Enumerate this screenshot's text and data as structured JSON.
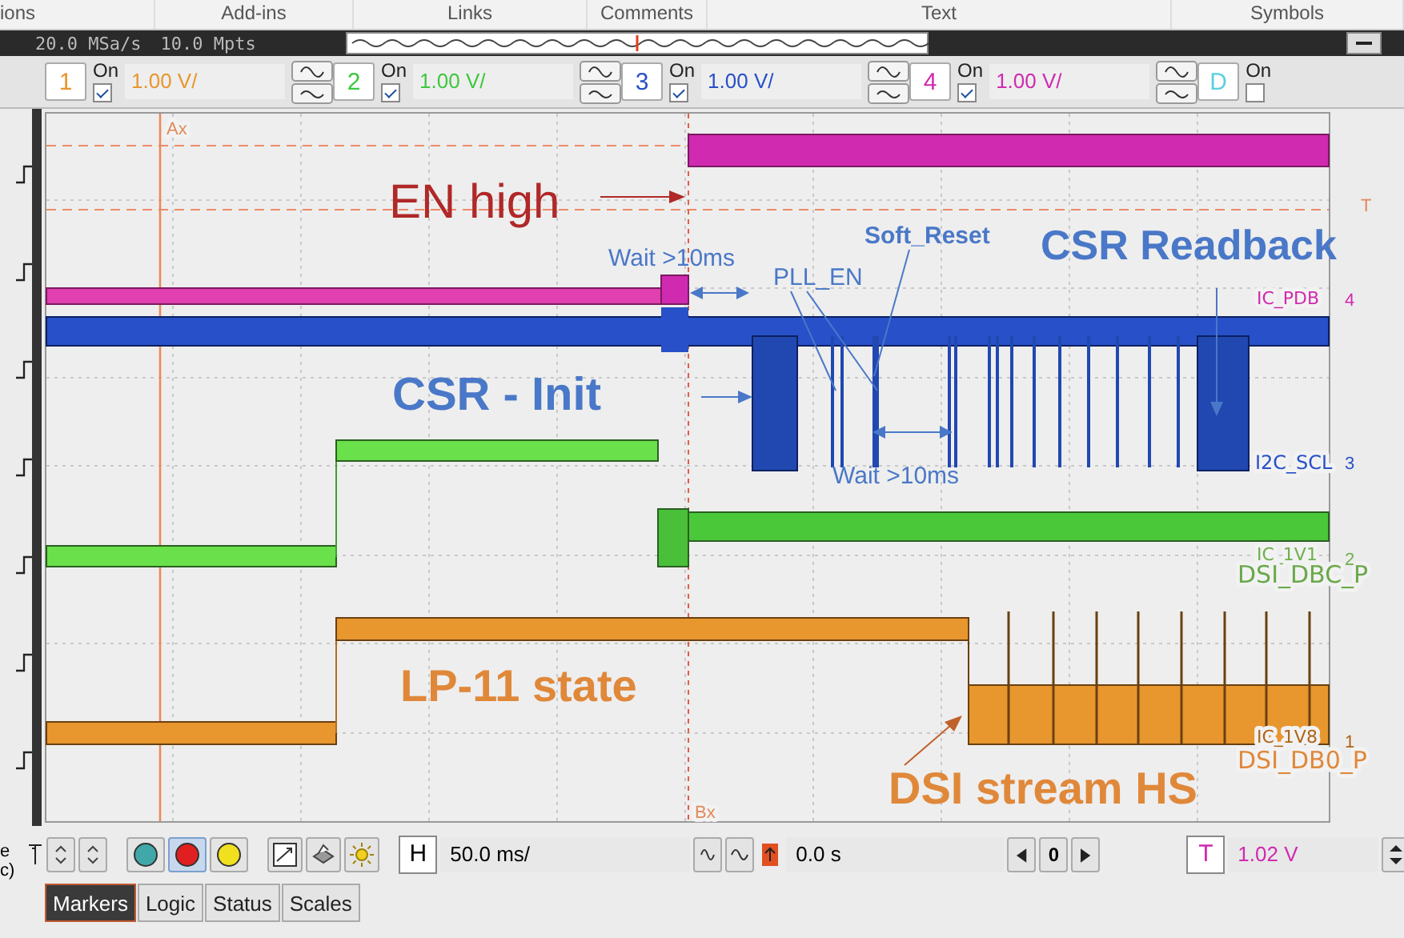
{
  "menu_tabs": [
    "ions",
    "Add-ins",
    "Links",
    "Comments",
    "Text",
    "Symbols"
  ],
  "acquisition": {
    "sample_rate": "20.0 MSa/s",
    "memory_depth": "10.0 Mpts"
  },
  "channels": [
    {
      "number": "1",
      "on_label": "On",
      "checked": true,
      "scale": "1.00 V/",
      "color": "#e8962e"
    },
    {
      "number": "2",
      "on_label": "On",
      "checked": true,
      "scale": "1.00 V/",
      "color": "#3ec83e"
    },
    {
      "number": "3",
      "on_label": "On",
      "checked": true,
      "scale": "1.00 V/",
      "color": "#2850c8"
    },
    {
      "number": "4",
      "on_label": "On",
      "checked": true,
      "scale": "1.00 V/",
      "color": "#d02ab0"
    }
  ],
  "digital": {
    "label": "D",
    "on_label": "On",
    "checked": false
  },
  "plot": {
    "markers": [
      "Ax",
      "Bx"
    ],
    "trigger_level_label": "T",
    "annotations": [
      {
        "text": "EN high",
        "color": "#b02828"
      },
      {
        "text": "Wait >10ms",
        "color": "#4a78c8"
      },
      {
        "text": "PLL_EN",
        "color": "#4a78c8"
      },
      {
        "text": "Soft_Reset",
        "color": "#4a78c8"
      },
      {
        "text": "CSR Readback",
        "color": "#4a78c8"
      },
      {
        "text": "CSR - Init",
        "color": "#4a78c8"
      },
      {
        "text": "Wait >10ms",
        "color": "#4a78c8"
      },
      {
        "text": "LP-11 state",
        "color": "#e0883a"
      },
      {
        "text": "DSI stream HS",
        "color": "#e0883a"
      }
    ],
    "trace_labels": [
      {
        "text": "IC_PDB",
        "color": "#d02ab0",
        "channel": "4"
      },
      {
        "text": "I2C_SCL",
        "color": "#2850c8",
        "channel": "3"
      },
      {
        "text": "IC_1V1",
        "color": "#6fb04e",
        "channel": "2"
      },
      {
        "text": "DSI_DBC_P",
        "color": "#6aa84a"
      },
      {
        "text": "IC_1V8",
        "color": "#b06418",
        "channel": "1"
      },
      {
        "text": "DSI_DB0_P",
        "color": "#e0883a"
      }
    ]
  },
  "toolbar": {
    "horizontal_label": "H",
    "time_scale": "50.0 ms/",
    "delay": "0.0 s",
    "step": "0",
    "trigger_label": "T",
    "trigger_level": "1.02 V"
  },
  "bottom_tabs": [
    {
      "label": "Markers",
      "selected": true
    },
    {
      "label": "Logic",
      "selected": false
    },
    {
      "label": "Status",
      "selected": false
    },
    {
      "label": "Scales",
      "selected": false
    }
  ],
  "left_edge_fragments": [
    "e",
    "c)"
  ]
}
